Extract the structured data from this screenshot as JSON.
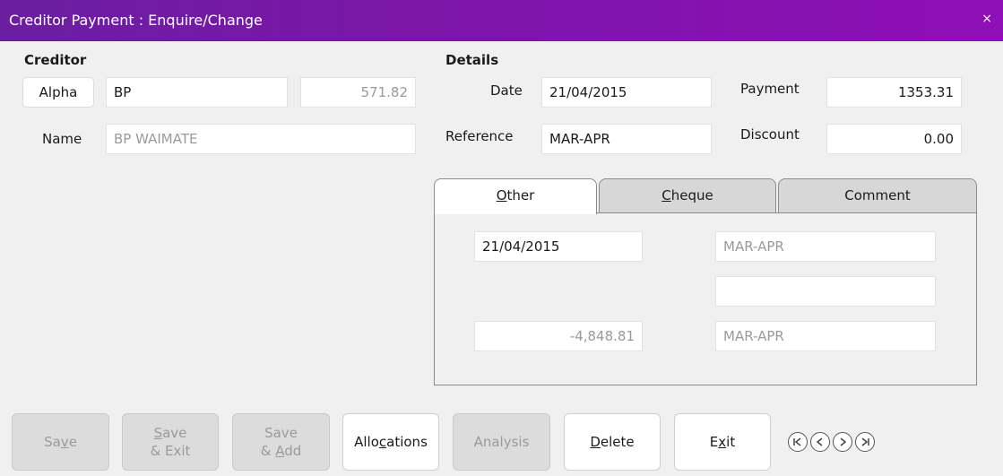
{
  "window": {
    "title": "Creditor Payment : Enquire/Change",
    "close_glyph": "×"
  },
  "creditor": {
    "heading": "Creditor",
    "alpha_button": "Alpha",
    "alpha_value": "BP",
    "balance": "571.82",
    "name_label": "Name",
    "name_value": "BP WAIMATE"
  },
  "details": {
    "heading": "Details",
    "date_label": "Date",
    "date_value": "21/04/2015",
    "reference_label": "Reference",
    "reference_value": "MAR-APR",
    "payment_label": "Payment",
    "payment_value": "1353.31",
    "discount_label": "Discount",
    "discount_value": "0.00"
  },
  "tabs": {
    "other": {
      "before": "",
      "key": "O",
      "after": "ther"
    },
    "cheque": {
      "before": "",
      "key": "C",
      "after": "heque"
    },
    "comment": {
      "label": "Comment"
    },
    "active": "other"
  },
  "other_tab": {
    "date": "21/04/2015",
    "ref1": "MAR-APR",
    "blank": "",
    "amount": "-4,848.81",
    "ref2": "MAR-APR"
  },
  "buttons": {
    "save": {
      "before": "Sa",
      "key": "v",
      "after": "e"
    },
    "save_exit": {
      "l1_key": "S",
      "l1_after": "ave",
      "l2": "& Exit"
    },
    "save_add": {
      "l1": "Save",
      "l2_before": "& ",
      "l2_key": "A",
      "l2_after": "dd"
    },
    "allocations": {
      "before": "Allo",
      "key": "c",
      "after": "ations"
    },
    "analysis": {
      "label": "Analysis"
    },
    "delete": {
      "before": "",
      "key": "D",
      "after": "elete"
    },
    "exit": {
      "before": "E",
      "key": "x",
      "after": "it"
    }
  },
  "icons": {
    "first": "first-record-icon",
    "prev": "previous-record-icon",
    "next": "next-record-icon",
    "last": "last-record-icon"
  },
  "colors": {
    "title_start": "#6a1fa0",
    "title_end": "#8e0fb6"
  }
}
